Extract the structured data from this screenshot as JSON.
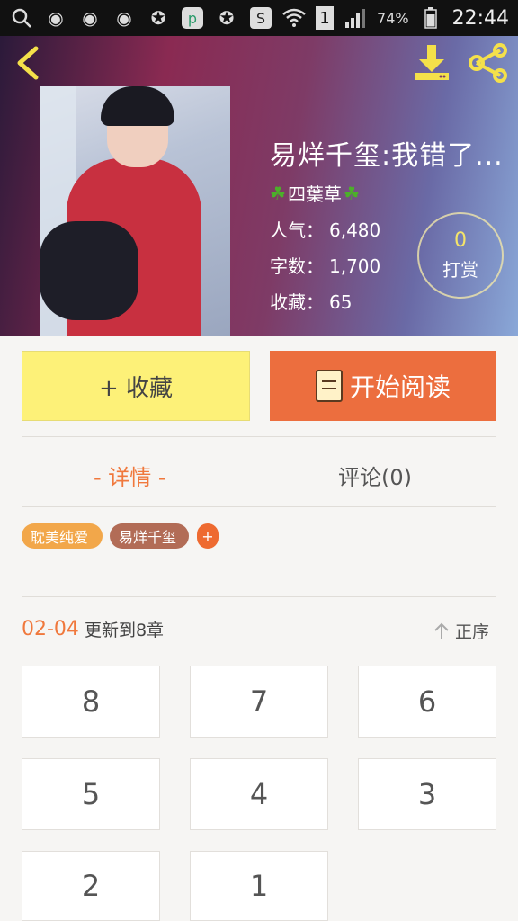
{
  "status_bar": {
    "battery": "74%",
    "time": "22:44",
    "sim": "1"
  },
  "header": {
    "title": "易烊千玺:我错了...",
    "author": "四葉草",
    "stats": [
      {
        "label": "人气：",
        "value": "6,480"
      },
      {
        "label": "字数：",
        "value": "1,700"
      },
      {
        "label": "收藏：",
        "value": "65"
      }
    ],
    "tip": {
      "count": "0",
      "label": "打赏"
    }
  },
  "actions": {
    "favorite_label": "+ 收藏",
    "read_label": "开始阅读"
  },
  "tabs": {
    "details": "- 详情 -",
    "comments": "评论(0)"
  },
  "tags": [
    "耽美纯爱",
    "易烊千玺",
    "+"
  ],
  "update": {
    "date": "02-04",
    "text": "更新到8章",
    "sort_label": "正序"
  },
  "chapters": [
    "8",
    "7",
    "6",
    "5",
    "4",
    "3",
    "2",
    "1"
  ]
}
